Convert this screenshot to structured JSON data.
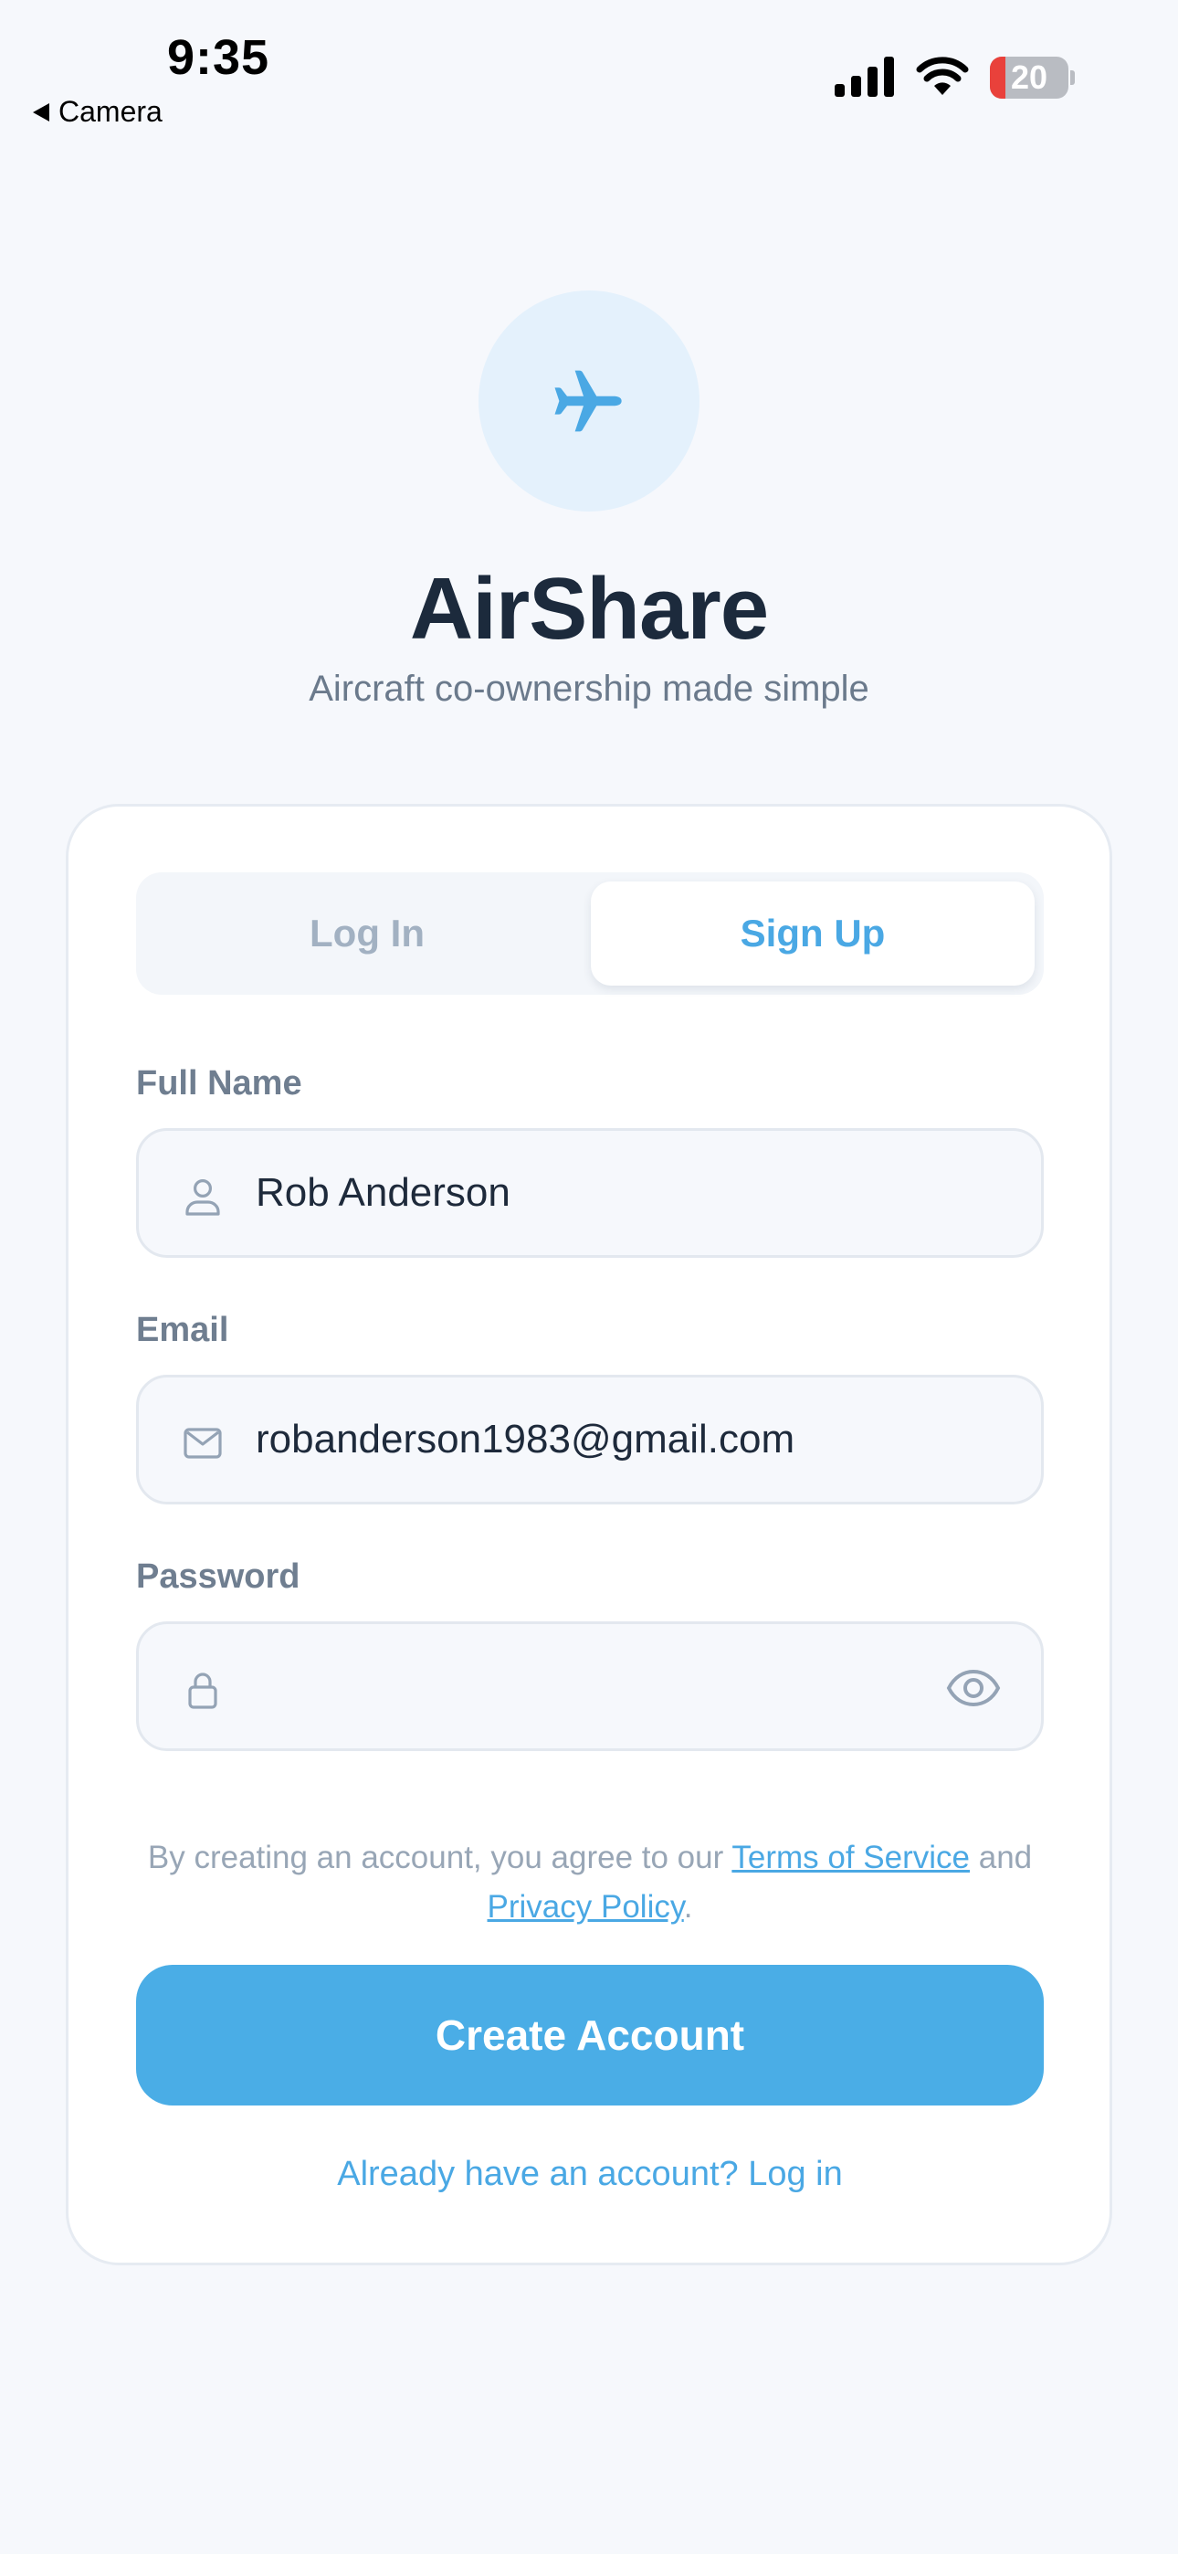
{
  "status_bar": {
    "time": "9:35",
    "back_app": "Camera",
    "battery_level": "20"
  },
  "header": {
    "logo_icon": "airplane-icon",
    "title": "AirShare",
    "subtitle": "Aircraft co-ownership made simple"
  },
  "tabs": {
    "login": "Log In",
    "signup": "Sign Up",
    "active": "Sign Up"
  },
  "form": {
    "full_name": {
      "label": "Full Name",
      "value": "Rob Anderson",
      "icon": "person-icon"
    },
    "email": {
      "label": "Email",
      "value": "robanderson1983@gmail.com",
      "icon": "mail-icon"
    },
    "password": {
      "label": "Password",
      "value": "",
      "icon": "lock-icon",
      "toggle_icon": "eye-icon"
    }
  },
  "terms": {
    "prefix": "By creating an account, you agree to our ",
    "terms_link": "Terms of Service",
    "middle": " and ",
    "privacy_link": "Privacy Policy",
    "suffix": "."
  },
  "actions": {
    "create_account": "Create Account",
    "login_prompt": "Already have an account? Log in"
  },
  "colors": {
    "accent": "#4aade6",
    "background": "#f6f8fc",
    "battery_low": "#e9413b"
  }
}
